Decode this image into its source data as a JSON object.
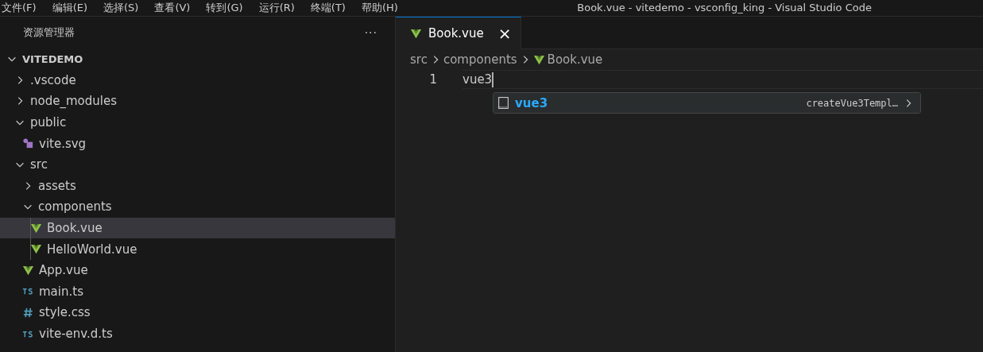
{
  "menu_bar": {
    "items": [
      "文件(F)",
      "编辑(E)",
      "选择(S)",
      "查看(V)",
      "转到(G)",
      "运行(R)",
      "终端(T)",
      "帮助(H)"
    ],
    "window_title": "Book.vue - vitedemo - vsconfig_king - Visual Studio Code"
  },
  "sidebar": {
    "title": "资源管理器",
    "more": "···",
    "tree": [
      {
        "label": "VITEDEMO",
        "kind": "root",
        "expanded": true,
        "selected": false,
        "children": [
          {
            "label": ".vscode",
            "kind": "folder",
            "expanded": false,
            "selected": false
          },
          {
            "label": "node_modules",
            "kind": "folder",
            "expanded": false,
            "selected": false
          },
          {
            "label": "public",
            "kind": "folder",
            "expanded": true,
            "selected": false,
            "children": [
              {
                "label": "vite.svg",
                "kind": "svg",
                "selected": false
              }
            ]
          },
          {
            "label": "src",
            "kind": "folder",
            "expanded": true,
            "selected": false,
            "children": [
              {
                "label": "assets",
                "kind": "folder",
                "expanded": false,
                "selected": false
              },
              {
                "label": "components",
                "kind": "folder",
                "expanded": true,
                "selected": false,
                "children": [
                  {
                    "label": "Book.vue",
                    "kind": "vue",
                    "selected": true
                  },
                  {
                    "label": "HelloWorld.vue",
                    "kind": "vue",
                    "selected": false
                  }
                ]
              },
              {
                "label": "App.vue",
                "kind": "vue",
                "selected": false
              },
              {
                "label": "main.ts",
                "kind": "ts",
                "selected": false
              },
              {
                "label": "style.css",
                "kind": "css",
                "selected": false
              },
              {
                "label": "vite-env.d.ts",
                "kind": "ts",
                "selected": false
              }
            ]
          }
        ]
      }
    ]
  },
  "tabs": [
    {
      "label": "Book.vue",
      "selected": true,
      "close": "×"
    }
  ],
  "breadcrumb": [
    "src",
    "components",
    "Book.vue"
  ],
  "editor": {
    "lines": [
      {
        "number": "1",
        "text": "vue3"
      }
    ]
  },
  "suggest": {
    "items": [
      {
        "label": "vue3",
        "detail": "createVue3Templ…",
        "selected": true
      }
    ]
  }
}
